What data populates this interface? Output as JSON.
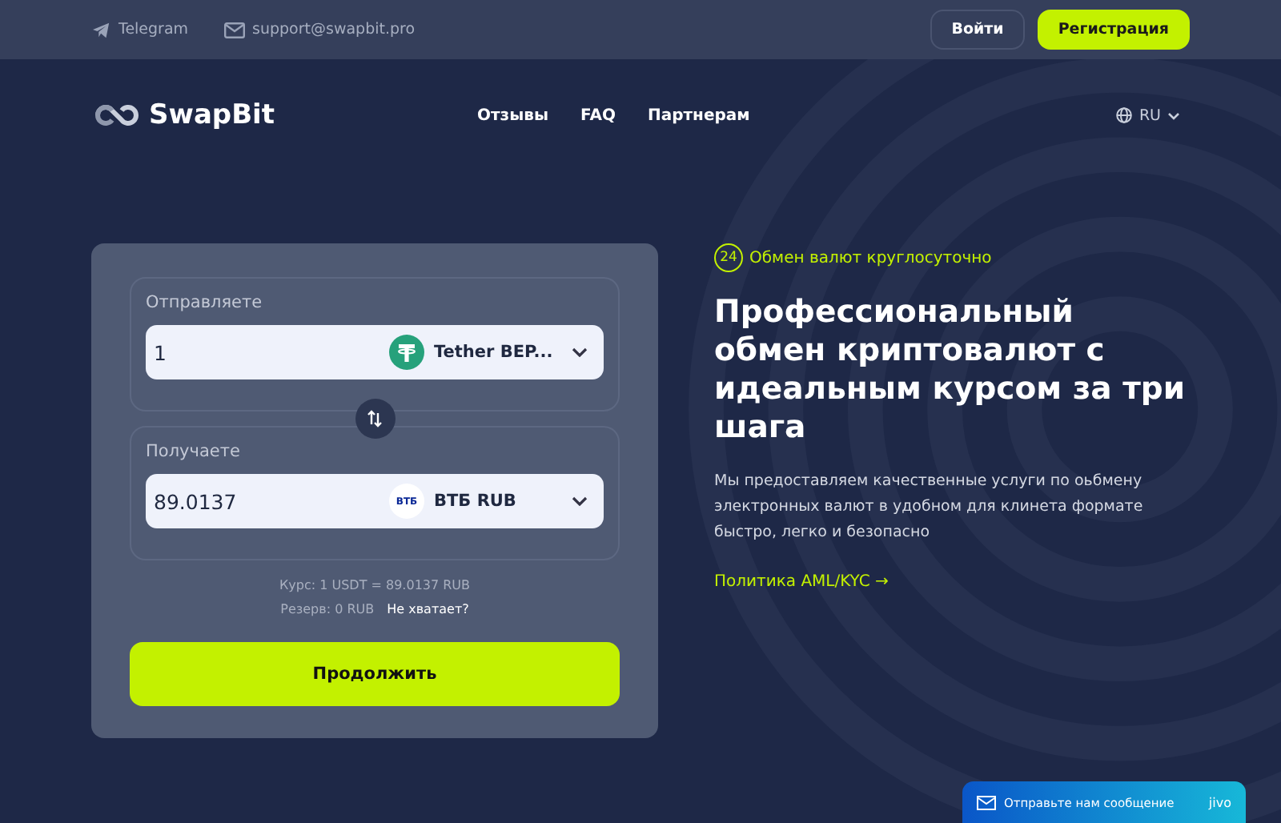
{
  "topbar": {
    "telegram": "Telegram",
    "email": "support@swapbit.pro",
    "login": "Войти",
    "register": "Регистрация"
  },
  "header": {
    "logo": "SwapBit",
    "nav": [
      "Отзывы",
      "FAQ",
      "Партнерам"
    ],
    "language": "RU"
  },
  "exchange": {
    "send": {
      "label": "Отправляете",
      "amount": "1",
      "currency": "Tether BEP..."
    },
    "receive": {
      "label": "Получаете",
      "amount": "89.0137",
      "currency": "ВТБ RUB",
      "badge": "ВТБ"
    },
    "rate": "Курс: 1 USDT = 89.0137 RUB",
    "reserve": "Резерв: 0 RUB",
    "not_enough": "Не хватает?",
    "continue": "Продолжить"
  },
  "hero": {
    "badge_number": "24",
    "badge": "Обмен валют круглосуточно",
    "title": "Профессиональный обмен криптовалют с идеальным курсом за три шага",
    "text": "Мы предоставляем качественные услуги по оьбмену электронных валют в удобном для клинета формате быстро, легко и безопасно",
    "link": "Политика AML/KYC →"
  },
  "chat": {
    "label": "Отправьте нам сообщение",
    "brand": "jivo"
  }
}
